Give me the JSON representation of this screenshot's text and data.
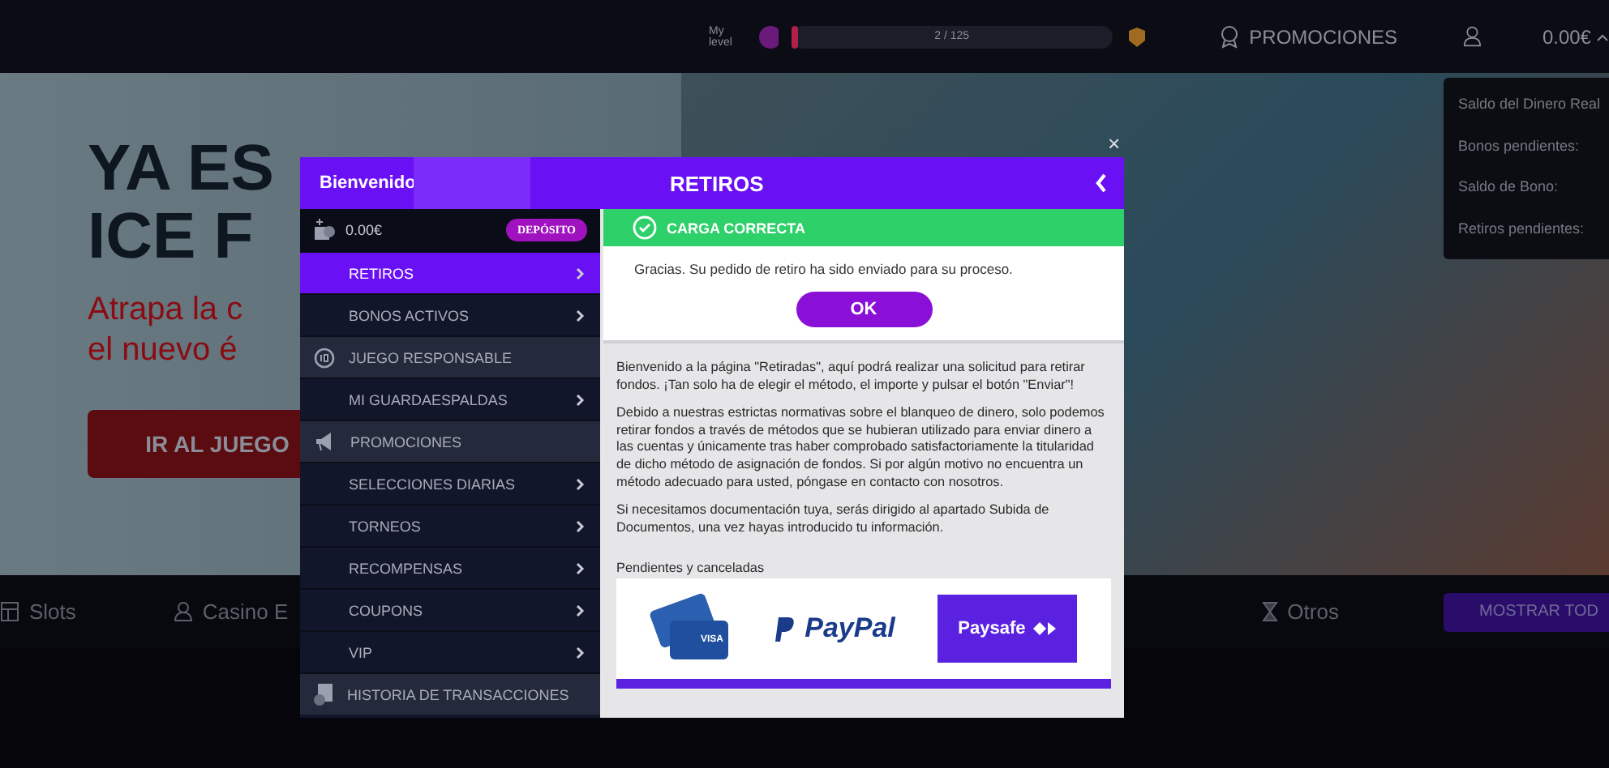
{
  "top_bar": {
    "level_label": "My level",
    "level": {
      "level": 0.02,
      "reading": "2 / 125"
    },
    "promotions": "PROMOCIONES",
    "balance": "0.00€"
  },
  "balance_dropdown": [
    "Saldo del Dinero Real",
    "Bonos pendientes:",
    "Saldo de Bono:",
    "Retiros pendientes:"
  ],
  "banner": {
    "title_lines": [
      "YA ES",
      "ICE F"
    ],
    "subtitle_lines": [
      "Atrapa la c",
      "el nuevo é"
    ],
    "button": "IR AL JUEGO"
  },
  "categories": {
    "items": [
      {
        "label": "Slots"
      },
      {
        "label": "Casino E"
      },
      {
        "label": "Otros"
      }
    ],
    "show_all": "MOSTRAR TOD"
  },
  "modal": {
    "close": "×",
    "welcome": "Bienvenido",
    "title": "RETIROS",
    "sidebar": {
      "balance": "0.00€",
      "deposit": "DEPÓSITO",
      "items": [
        {
          "kind": "item",
          "label": "RETIROS",
          "selected": true
        },
        {
          "kind": "item",
          "label": "BONOS ACTIVOS",
          "selected": false
        },
        {
          "kind": "section",
          "label": "JUEGO RESPONSABLE",
          "selected": false
        },
        {
          "kind": "item",
          "label": "MI GUARDAESPALDAS",
          "selected": false
        },
        {
          "kind": "section",
          "label": "PROMOCIONES",
          "selected": false
        },
        {
          "kind": "item",
          "label": "SELECCIONES DIARIAS",
          "selected": false
        },
        {
          "kind": "item",
          "label": "TORNEOS",
          "selected": false
        },
        {
          "kind": "item",
          "label": "RECOMPENSAS",
          "selected": false
        },
        {
          "kind": "item",
          "label": "COUPONS",
          "selected": false
        },
        {
          "kind": "item",
          "label": "VIP",
          "selected": false
        },
        {
          "kind": "section",
          "label": "HISTORIA DE TRANSACCIONES",
          "selected": false
        }
      ]
    },
    "notice": {
      "title": "CARGA CORRECTA",
      "message": "Gracias. Su pedido de retiro ha sido enviado para su proceso.",
      "button": "OK"
    },
    "paragraphs": [
      "Bienvenido a la página \"Retiradas\", aquí podrá realizar una solicitud para retirar fondos. ¡Tan solo ha de elegir el método, el importe y pulsar el botón \"Enviar\"!",
      "Debido a nuestras estrictas normativas sobre el blanqueo de dinero, solo podemos retirar fondos a través de métodos que se hubieran utilizado para enviar dinero a las cuentas y únicamente tras haber comprobado satisfactoriamente la titularidad de dicho método de asignación de fondos. Si por algún motivo no encuentra un método adecuado para usted, póngase en contacto con nosotros.",
      "Si necesitamos documentación tuya, serás dirigido al apartado Subida de Documentos, una vez hayas introducido tu información."
    ],
    "pending_label": "Pendientes y canceladas",
    "methods": [
      {
        "kind": "cards",
        "label": "VISA"
      },
      {
        "kind": "paypal",
        "label": "PayPal"
      },
      {
        "kind": "paysafe",
        "label": "Paysafe"
      }
    ]
  }
}
